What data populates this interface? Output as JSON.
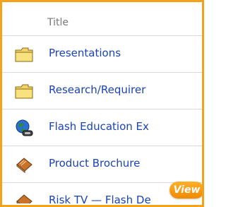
{
  "table": {
    "column_title": "Title",
    "rows": [
      {
        "label": "Presentations",
        "icon": "folder-icon"
      },
      {
        "label": "Research/Requirer",
        "icon": "folder-icon"
      },
      {
        "label": "Flash Education Ex",
        "icon": "web-link-icon"
      },
      {
        "label": "Product Brochure",
        "icon": "book-icon"
      },
      {
        "label": "Risk TV — Flash De",
        "icon": "book-icon"
      }
    ]
  },
  "view_button": {
    "label": "View"
  },
  "colors": {
    "frame_border": "#f5a21b",
    "link_text": "#1a43b8",
    "header_text": "#7a7a7a",
    "view_button": "#f5a21b"
  }
}
